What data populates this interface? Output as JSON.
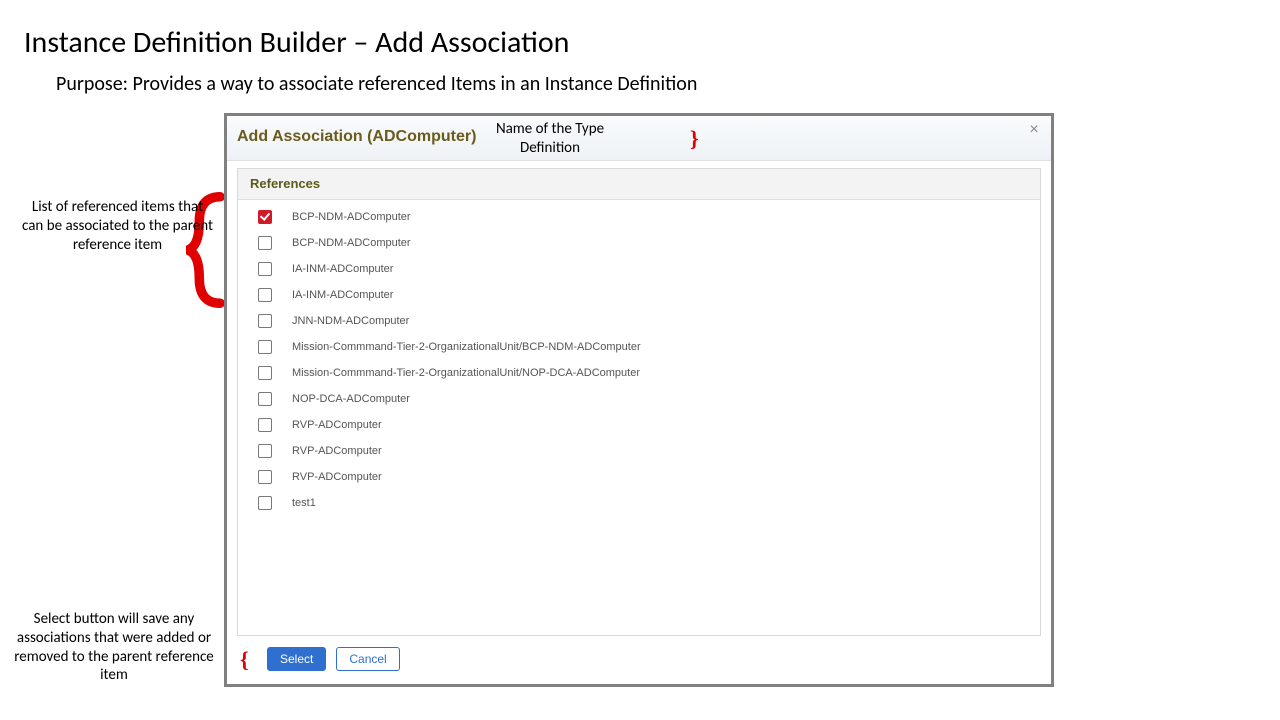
{
  "page": {
    "title": "Instance Definition Builder – Add Association",
    "purpose": "Purpose: Provides a way to associate referenced Items in an Instance Definition"
  },
  "dialog": {
    "title": "Add Association (ADComputer)",
    "close_glyph": "×",
    "section_header": "References",
    "references": [
      {
        "label": "BCP-NDM-ADComputer",
        "checked": true
      },
      {
        "label": "BCP-NDM-ADComputer",
        "checked": false
      },
      {
        "label": "IA-INM-ADComputer",
        "checked": false
      },
      {
        "label": "IA-INM-ADComputer",
        "checked": false
      },
      {
        "label": "JNN-NDM-ADComputer",
        "checked": false
      },
      {
        "label": "Mission-Commmand-Tier-2-OrganizationalUnit/BCP-NDM-ADComputer",
        "checked": false
      },
      {
        "label": "Mission-Commmand-Tier-2-OrganizationalUnit/NOP-DCA-ADComputer",
        "checked": false
      },
      {
        "label": "NOP-DCA-ADComputer",
        "checked": false
      },
      {
        "label": "RVP-ADComputer",
        "checked": false
      },
      {
        "label": "RVP-ADComputer",
        "checked": false
      },
      {
        "label": "RVP-ADComputer",
        "checked": false
      },
      {
        "label": "test1",
        "checked": false
      }
    ],
    "footer": {
      "select_label": "Select",
      "cancel_label": "Cancel"
    }
  },
  "annotations": {
    "title_note": "Name of the Type Definition",
    "list_note": "List of referenced items that can be associated to the parent reference item",
    "footer_note": "Select button will save any associations that were added or removed to the parent reference item",
    "brace_glyph_close": "}",
    "brace_glyph_open": "{"
  }
}
